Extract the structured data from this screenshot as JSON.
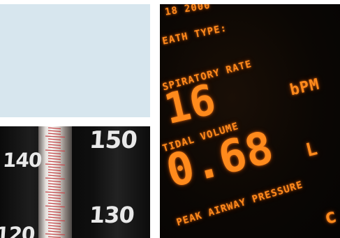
{
  "monitor": {
    "date": "18 2000",
    "breath_type_label": "EATH TYPE:",
    "resp_rate_label": "SPIRATORY RATE",
    "resp_rate_value": "16",
    "resp_rate_unit": "bPM",
    "tidal_volume_label": "TIDAL VOLUME",
    "tidal_volume_value": "0.68",
    "tidal_volume_unit": "L",
    "peak_pressure_label": "PEAK AIRWAY PRESSURE",
    "peak_pressure_unit_partial": "c",
    "display_color": "#ff8a1c"
  },
  "gauge": {
    "labels": [
      "150",
      "140",
      "130",
      "120"
    ],
    "mercury_color": "#c4474a"
  },
  "photo_panel": {
    "color": "#d7e6ee"
  }
}
